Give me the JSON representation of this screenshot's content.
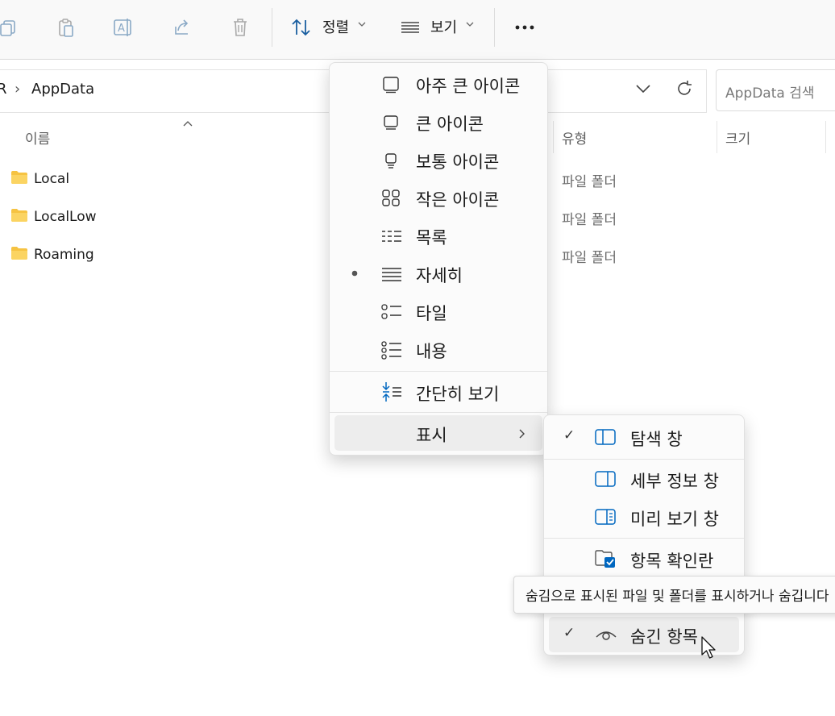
{
  "toolbar": {
    "sort_label": "정렬",
    "view_label": "보기",
    "more_glyph": "•••"
  },
  "address": {
    "crumb_prefix": "R",
    "crumb_sep": "›",
    "current": "AppData",
    "search_placeholder": "AppData 검색"
  },
  "columns": {
    "name": "이름",
    "type": "유형",
    "size": "크기"
  },
  "files": [
    {
      "name": "Local",
      "type": "파일 폴더"
    },
    {
      "name": "LocalLow",
      "type": "파일 폴더"
    },
    {
      "name": "Roaming",
      "type": "파일 폴더"
    }
  ],
  "view_menu": {
    "items": [
      {
        "label": "아주 큰 아이콘",
        "icon": "extra-large-icons-icon"
      },
      {
        "label": "큰 아이콘",
        "icon": "large-icons-icon"
      },
      {
        "label": "보통 아이콘",
        "icon": "medium-icons-icon"
      },
      {
        "label": "작은 아이콘",
        "icon": "small-icons-icon"
      },
      {
        "label": "목록",
        "icon": "list-icon"
      },
      {
        "label": "자세히",
        "icon": "details-icon",
        "selected": true
      },
      {
        "label": "타일",
        "icon": "tiles-icon"
      },
      {
        "label": "내용",
        "icon": "content-icon"
      }
    ],
    "compact_label": "간단히 보기",
    "show_label": "표시"
  },
  "show_submenu": {
    "items": [
      {
        "label": "탐색 창",
        "checked": true
      },
      {
        "label": "세부 정보 창",
        "checked": false
      },
      {
        "label": "미리 보기 창",
        "checked": false
      },
      {
        "label": "항목 확인란",
        "checked": false
      },
      {
        "label": "숨긴 항목",
        "checked": true
      }
    ],
    "check_glyph": "✓"
  },
  "tooltip": {
    "text": "숨김으로 표시된 파일 및 폴더를 표시하거나 숨깁니다"
  },
  "colors": {
    "accent": "#0067c0",
    "folder": "#f6c342",
    "menu_bg": "#fbfbfb"
  }
}
